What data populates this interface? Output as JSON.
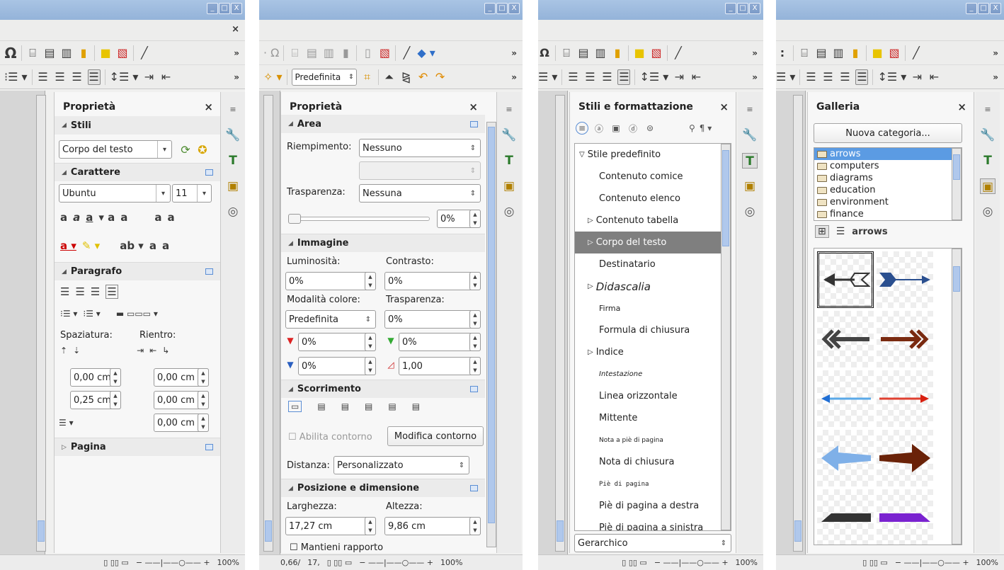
{
  "window_controls": [
    "_",
    "□",
    "X"
  ],
  "app_close": "×",
  "more": "»",
  "status_zoom": "100%",
  "status_views": "▯ ▯▯ ▭",
  "status_slider": "−  ——|——○——  +",
  "p1": {
    "title": "Proprietà",
    "close": "×",
    "stili": {
      "header": "Stili",
      "style_value": "Corpo del testo"
    },
    "carattere": {
      "header": "Carattere",
      "font": "Ubuntu",
      "size": "11"
    },
    "paragrafo": {
      "header": "Paragrafo",
      "spaziatura": "Spaziatura:",
      "rientro": "Rientro:",
      "above": "0,00 cm",
      "before": "0,00 cm",
      "below": "0,25 cm",
      "after": "0,00 cm",
      "first": "0,00 cm"
    },
    "pagina": {
      "header": "Pagina"
    }
  },
  "p2": {
    "title": "Proprietà",
    "close": "×",
    "toolbar_default": "Predefinita",
    "area": {
      "header": "Area",
      "riempimento_label": "Riempimento:",
      "riempimento": "Nessuno",
      "trasparenza_label": "Trasparenza:",
      "trasparenza": "Nessuna",
      "slider_value": "0%"
    },
    "immagine": {
      "header": "Immagine",
      "luminosita_label": "Luminosità:",
      "luminosita": "0%",
      "contrasto_label": "Contrasto:",
      "contrasto": "0%",
      "modalita_label": "Modalità colore:",
      "modalita": "Predefinita",
      "trasp_label": "Trasparenza:",
      "trasp": "0%",
      "red": "0%",
      "green": "0%",
      "blue": "0%",
      "gamma": "1,00"
    },
    "scorrimento": {
      "header": "Scorrimento",
      "abilita": "Abilita contorno",
      "modifica": "Modifica contorno",
      "distanza_label": "Distanza:",
      "distanza": "Personalizzato"
    },
    "posizione": {
      "header": "Posizione e dimensione",
      "larghezza_label": "Larghezza:",
      "larghezza": "17,27 cm",
      "altezza_label": "Altezza:",
      "altezza": "9,86 cm",
      "mantieni": "Mantieni rapporto"
    },
    "status_pos": "0,66/",
    "status_size": "17,"
  },
  "p3": {
    "title": "Stili e formattazione",
    "close": "×",
    "filter": "Gerarchico",
    "items": [
      {
        "label": "Stile predefinito",
        "expander": "▽"
      },
      {
        "label": "Contenuto comice",
        "expander": ""
      },
      {
        "label": "Contenuto elenco",
        "expander": ""
      },
      {
        "label": "Contenuto tabella",
        "expander": "▷"
      },
      {
        "label": "Corpo del testo",
        "expander": "▷"
      },
      {
        "label": "Destinatario",
        "expander": ""
      },
      {
        "label": "Didascalia",
        "expander": "▷"
      },
      {
        "label": "Firma",
        "expander": ""
      },
      {
        "label": "Formula di chiusura",
        "expander": ""
      },
      {
        "label": "Indice",
        "expander": "▷"
      },
      {
        "label": "Intestazione",
        "expander": ""
      },
      {
        "label": "Linea orizzontale",
        "expander": ""
      },
      {
        "label": "Mittente",
        "expander": ""
      },
      {
        "label": "Nota a piè di pagina",
        "expander": ""
      },
      {
        "label": "Nota di chiusura",
        "expander": ""
      },
      {
        "label": "Piè di pagina",
        "expander": ""
      },
      {
        "label": "Piè di pagina a destra",
        "expander": ""
      },
      {
        "label": "Piè di pagina a sinistra",
        "expander": ""
      }
    ]
  },
  "p4": {
    "title": "Galleria",
    "close": "×",
    "new_category": "Nuova categoria...",
    "categories": [
      "arrows",
      "computers",
      "diagrams",
      "education",
      "environment",
      "finance"
    ],
    "current": "arrows"
  },
  "colors": {
    "accent": "#5b9be3",
    "selection": "#7f7f7f",
    "titlebar": "#a9c4e4"
  }
}
